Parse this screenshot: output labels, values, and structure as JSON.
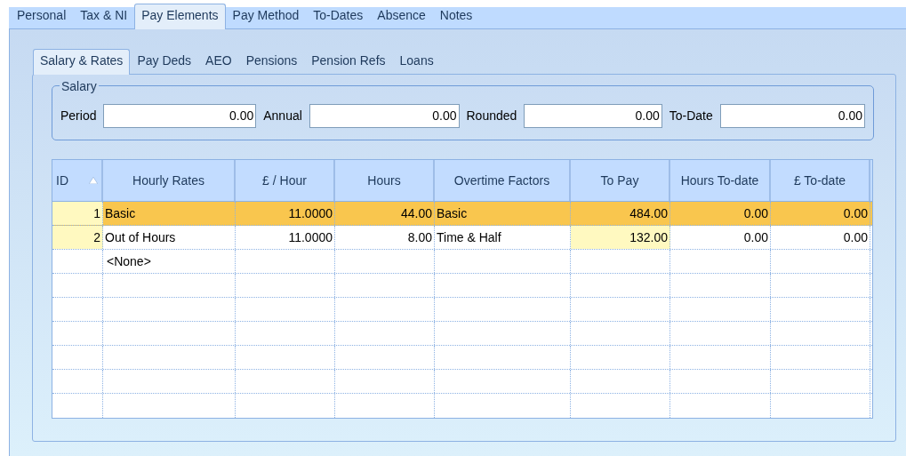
{
  "tabs": [
    {
      "label": "Personal",
      "selected": false
    },
    {
      "label": "Tax & NI",
      "selected": false
    },
    {
      "label": "Pay Elements",
      "selected": true
    },
    {
      "label": "Pay Method",
      "selected": false
    },
    {
      "label": "To-Dates",
      "selected": false
    },
    {
      "label": "Absence",
      "selected": false
    },
    {
      "label": "Notes",
      "selected": false
    }
  ],
  "sub_tabs": [
    {
      "label": "Salary & Rates",
      "selected": true
    },
    {
      "label": "Pay Deds",
      "selected": false
    },
    {
      "label": "AEO",
      "selected": false
    },
    {
      "label": "Pensions",
      "selected": false
    },
    {
      "label": "Pension Refs",
      "selected": false
    },
    {
      "label": "Loans",
      "selected": false
    }
  ],
  "salary": {
    "title": "Salary",
    "fields": [
      {
        "label": "Period",
        "value": "0.00"
      },
      {
        "label": "Annual",
        "value": "0.00"
      },
      {
        "label": "Rounded",
        "value": "0.00"
      },
      {
        "label": "To-Date",
        "value": "0.00"
      }
    ]
  },
  "table": {
    "columns": [
      {
        "label": "ID",
        "kind": "number",
        "sorted": true
      },
      {
        "label": "Hourly Rates",
        "kind": "text",
        "sorted": false
      },
      {
        "label": "£ / Hour",
        "kind": "number",
        "sorted": false
      },
      {
        "label": "Hours",
        "kind": "number",
        "sorted": false
      },
      {
        "label": "Overtime Factors",
        "kind": "text",
        "sorted": false
      },
      {
        "label": "To Pay",
        "kind": "number",
        "sorted": false
      },
      {
        "label": "Hours To-date",
        "kind": "number",
        "sorted": false
      },
      {
        "label": "£ To-date",
        "kind": "number",
        "sorted": false
      }
    ],
    "rows": [
      {
        "kind": "data",
        "selected": true,
        "cells": [
          {
            "text": "1",
            "highlighted": true
          },
          {
            "text": "Basic",
            "highlighted": false
          },
          {
            "text": "11.0000",
            "highlighted": false
          },
          {
            "text": "44.00",
            "highlighted": false
          },
          {
            "text": "Basic",
            "highlighted": false
          },
          {
            "text": "484.00",
            "highlighted": false
          },
          {
            "text": "0.00",
            "highlighted": false
          },
          {
            "text": "0.00",
            "highlighted": false
          }
        ]
      },
      {
        "kind": "data",
        "selected": false,
        "cells": [
          {
            "text": "2",
            "highlighted": true
          },
          {
            "text": "Out of Hours",
            "highlighted": false
          },
          {
            "text": "11.0000",
            "highlighted": false
          },
          {
            "text": "8.00",
            "highlighted": false
          },
          {
            "text": "Time & Half",
            "highlighted": false
          },
          {
            "text": "132.00",
            "highlighted": true
          },
          {
            "text": "0.00",
            "highlighted": false
          },
          {
            "text": "0.00",
            "highlighted": false
          }
        ]
      },
      {
        "kind": "new",
        "selected": false,
        "text": "<None>"
      }
    ]
  }
}
